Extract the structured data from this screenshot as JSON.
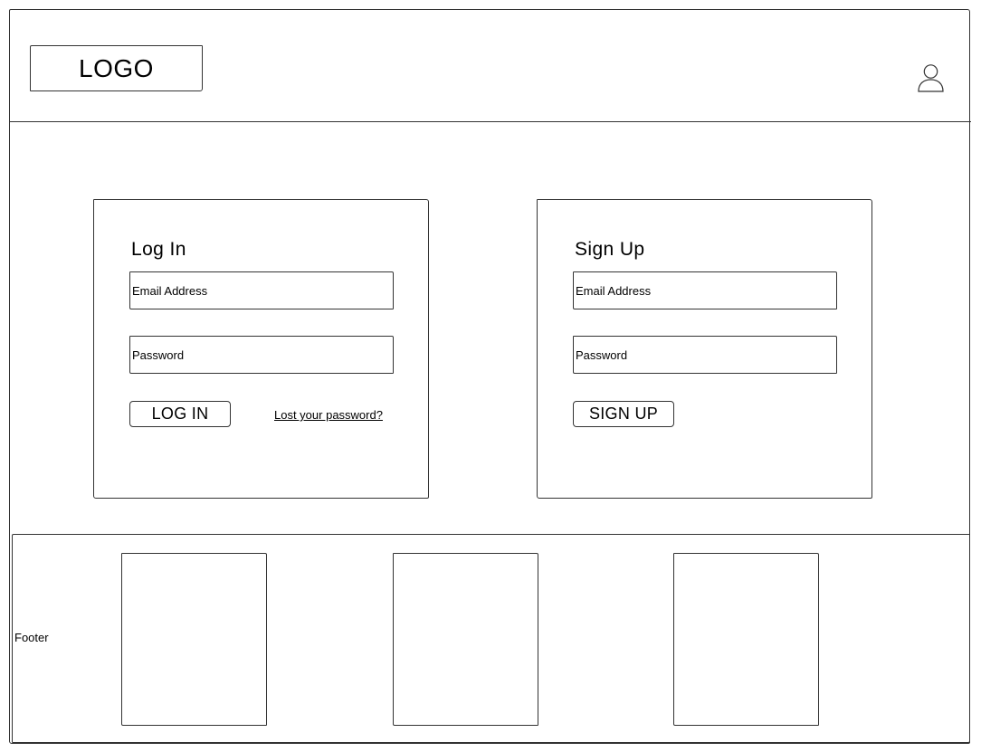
{
  "header": {
    "logo_text": "LOGO",
    "user_icon": "user-icon"
  },
  "login": {
    "title": "Log In",
    "email_label": "Email Address",
    "password_label": "Password",
    "button_label": "LOG IN",
    "lost_password_link": "Lost your password?"
  },
  "signup": {
    "title": "Sign Up",
    "email_label": "Email Address",
    "password_label": "Password",
    "button_label": "SIGN UP"
  },
  "footer": {
    "label": "Footer"
  },
  "colors": {
    "stroke": "#333333",
    "background": "#ffffff"
  }
}
